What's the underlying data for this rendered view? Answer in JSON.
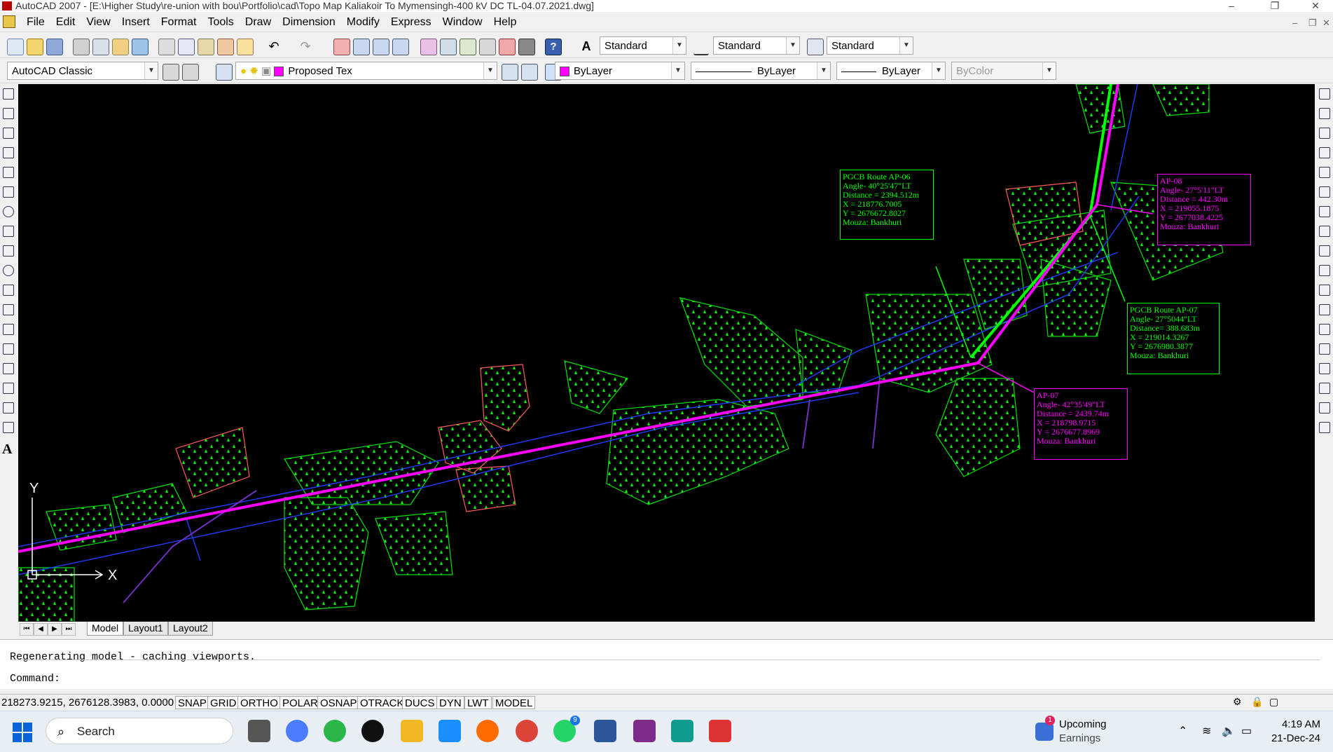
{
  "window": {
    "title": "AutoCAD 2007 - [E:\\Higher Study\\re-union with bou\\Portfolio\\cad\\Topo Map Kaliakoir To Mymensingh-400 kV DC TL-04.07.2021.dwg]",
    "controls": [
      "–",
      "❐",
      "✕"
    ]
  },
  "menu": [
    "File",
    "Edit",
    "View",
    "Insert",
    "Format",
    "Tools",
    "Draw",
    "Dimension",
    "Modify",
    "Express",
    "Window",
    "Help"
  ],
  "styles_toolbar": {
    "text_style": "Standard",
    "dim_style": "Standard",
    "table_style": "Standard"
  },
  "workspace": "AutoCAD Classic",
  "layer": "Proposed Tex",
  "properties": {
    "color": "ByLayer",
    "linetype": "ByLayer",
    "lineweight": "ByLayer",
    "plotstyle": "ByColor"
  },
  "colors": {
    "route_magenta": "#ff00ff",
    "route_green": "#00ff00",
    "road_blue": "#1e3cff",
    "canvas": "#000000"
  },
  "annotations": {
    "ap06": [
      "PGCB Route AP-06",
      "Angle- 40°25'47\"LT",
      "Distance = 2394.512m",
      "X = 218776.7005",
      "Y = 2676672.8027",
      "Mouza: Bankhuri"
    ],
    "ap07_pgcb": [
      "PGCB Route AP-07",
      "Angle- 27°5044\"LT",
      "Distance= 388.683m",
      "X = 219014.3267",
      "Y = 2676980.3877",
      "Mouza: Bankhuri"
    ],
    "ap08": [
      "AP-08",
      "Angle- 27°5'11\"LT",
      "Distance = 442.30m",
      "X = 219055.1875",
      "Y = 2677038.4225",
      "Mouza: Bankhuri"
    ],
    "ap07": [
      "AP-07",
      "Angle- 42°35'49\"LT",
      "Distance = 2439.74m",
      "X = 218798.9715",
      "Y = 2676677.8969",
      "Mouza: Bankhuri"
    ]
  },
  "ucs": {
    "y_label": "Y",
    "x_label": "X"
  },
  "layout_tabs": [
    "Model",
    "Layout1",
    "Layout2"
  ],
  "command": {
    "history": "Regenerating model - caching viewports.",
    "prompt": "Command:"
  },
  "status": {
    "coords": "218273.9215, 2676128.3983, 0.0000",
    "toggles": [
      "SNAP",
      "GRID",
      "ORTHO",
      "POLAR",
      "OSNAP",
      "OTRACK",
      "DUCS",
      "DYN",
      "LWT",
      "MODEL"
    ]
  },
  "taskbar": {
    "search_label": "Search",
    "widget_title": "Upcoming",
    "widget_sub": "Earnings",
    "widget_badge": "1",
    "whatsapp_badge": "9",
    "time": "4:19 AM",
    "date": "21-Dec-24"
  }
}
